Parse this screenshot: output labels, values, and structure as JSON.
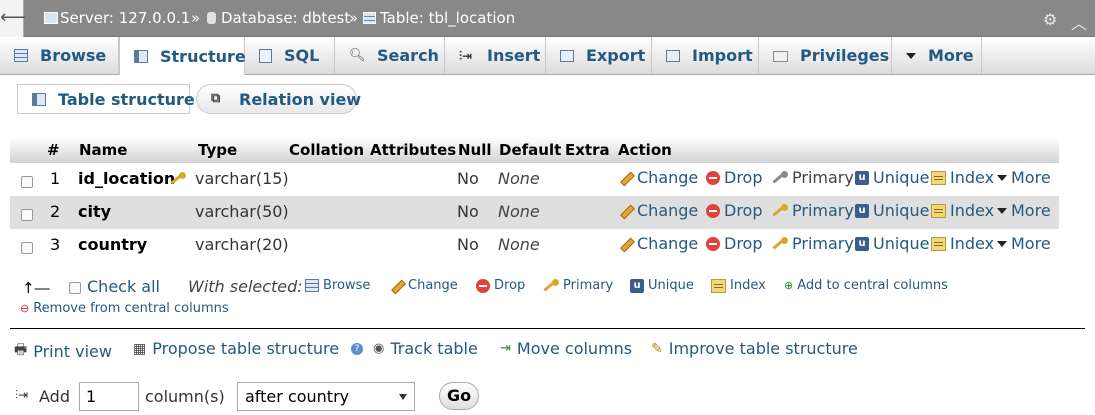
{
  "breadcrumb": {
    "server": "Server: 127.0.0.1",
    "sep1": "»",
    "database": "Database: dbtest",
    "sep2": "»",
    "table": "Table: tbl_location"
  },
  "tabs": [
    {
      "label": "Browse",
      "icon": "browse-icon"
    },
    {
      "label": "Structure",
      "icon": "structure-icon",
      "active": true
    },
    {
      "label": "SQL",
      "icon": "sql-icon"
    },
    {
      "label": "Search",
      "icon": "search-icon"
    },
    {
      "label": "Insert",
      "icon": "insert-icon"
    },
    {
      "label": "Export",
      "icon": "export-icon"
    },
    {
      "label": "Import",
      "icon": "import-icon"
    },
    {
      "label": "Privileges",
      "icon": "privileges-icon"
    },
    {
      "label": "More",
      "icon": "chevron-down-icon"
    }
  ],
  "subtabs": {
    "table_structure": "Table structure",
    "relation_view": "Relation view"
  },
  "columns": [
    "#",
    "Name",
    "Type",
    "Collation",
    "Attributes",
    "Null",
    "Default",
    "Extra",
    "Action"
  ],
  "rows": [
    {
      "num": "1",
      "name": "id_location",
      "type": "varchar(15)",
      "null": "No",
      "default": "None",
      "primary_key": true
    },
    {
      "num": "2",
      "name": "city",
      "type": "varchar(50)",
      "null": "No",
      "default": "None",
      "primary_key": false
    },
    {
      "num": "3",
      "name": "country",
      "type": "varchar(20)",
      "null": "No",
      "default": "None",
      "primary_key": false
    }
  ],
  "actions": {
    "change": "Change",
    "drop": "Drop",
    "primary": "Primary",
    "unique": "Unique",
    "index": "Index",
    "more": "More"
  },
  "with_selected": {
    "check_all": "Check all",
    "label": "With selected:",
    "browse": "Browse",
    "change": "Change",
    "drop": "Drop",
    "primary": "Primary",
    "unique": "Unique",
    "index": "Index",
    "add_central": "Add to central columns",
    "remove_central": "Remove from central columns"
  },
  "tools": {
    "print_view": "Print view",
    "propose": "Propose table structure",
    "track": "Track table",
    "move": "Move columns",
    "improve": "Improve table structure"
  },
  "add_column": {
    "label": "Add",
    "count": "1",
    "unit": "column(s)",
    "position": "after country",
    "go": "Go"
  },
  "colors": {
    "link": "#235a81",
    "topbar": "#888888",
    "row_alt": "#dfdfdf"
  }
}
